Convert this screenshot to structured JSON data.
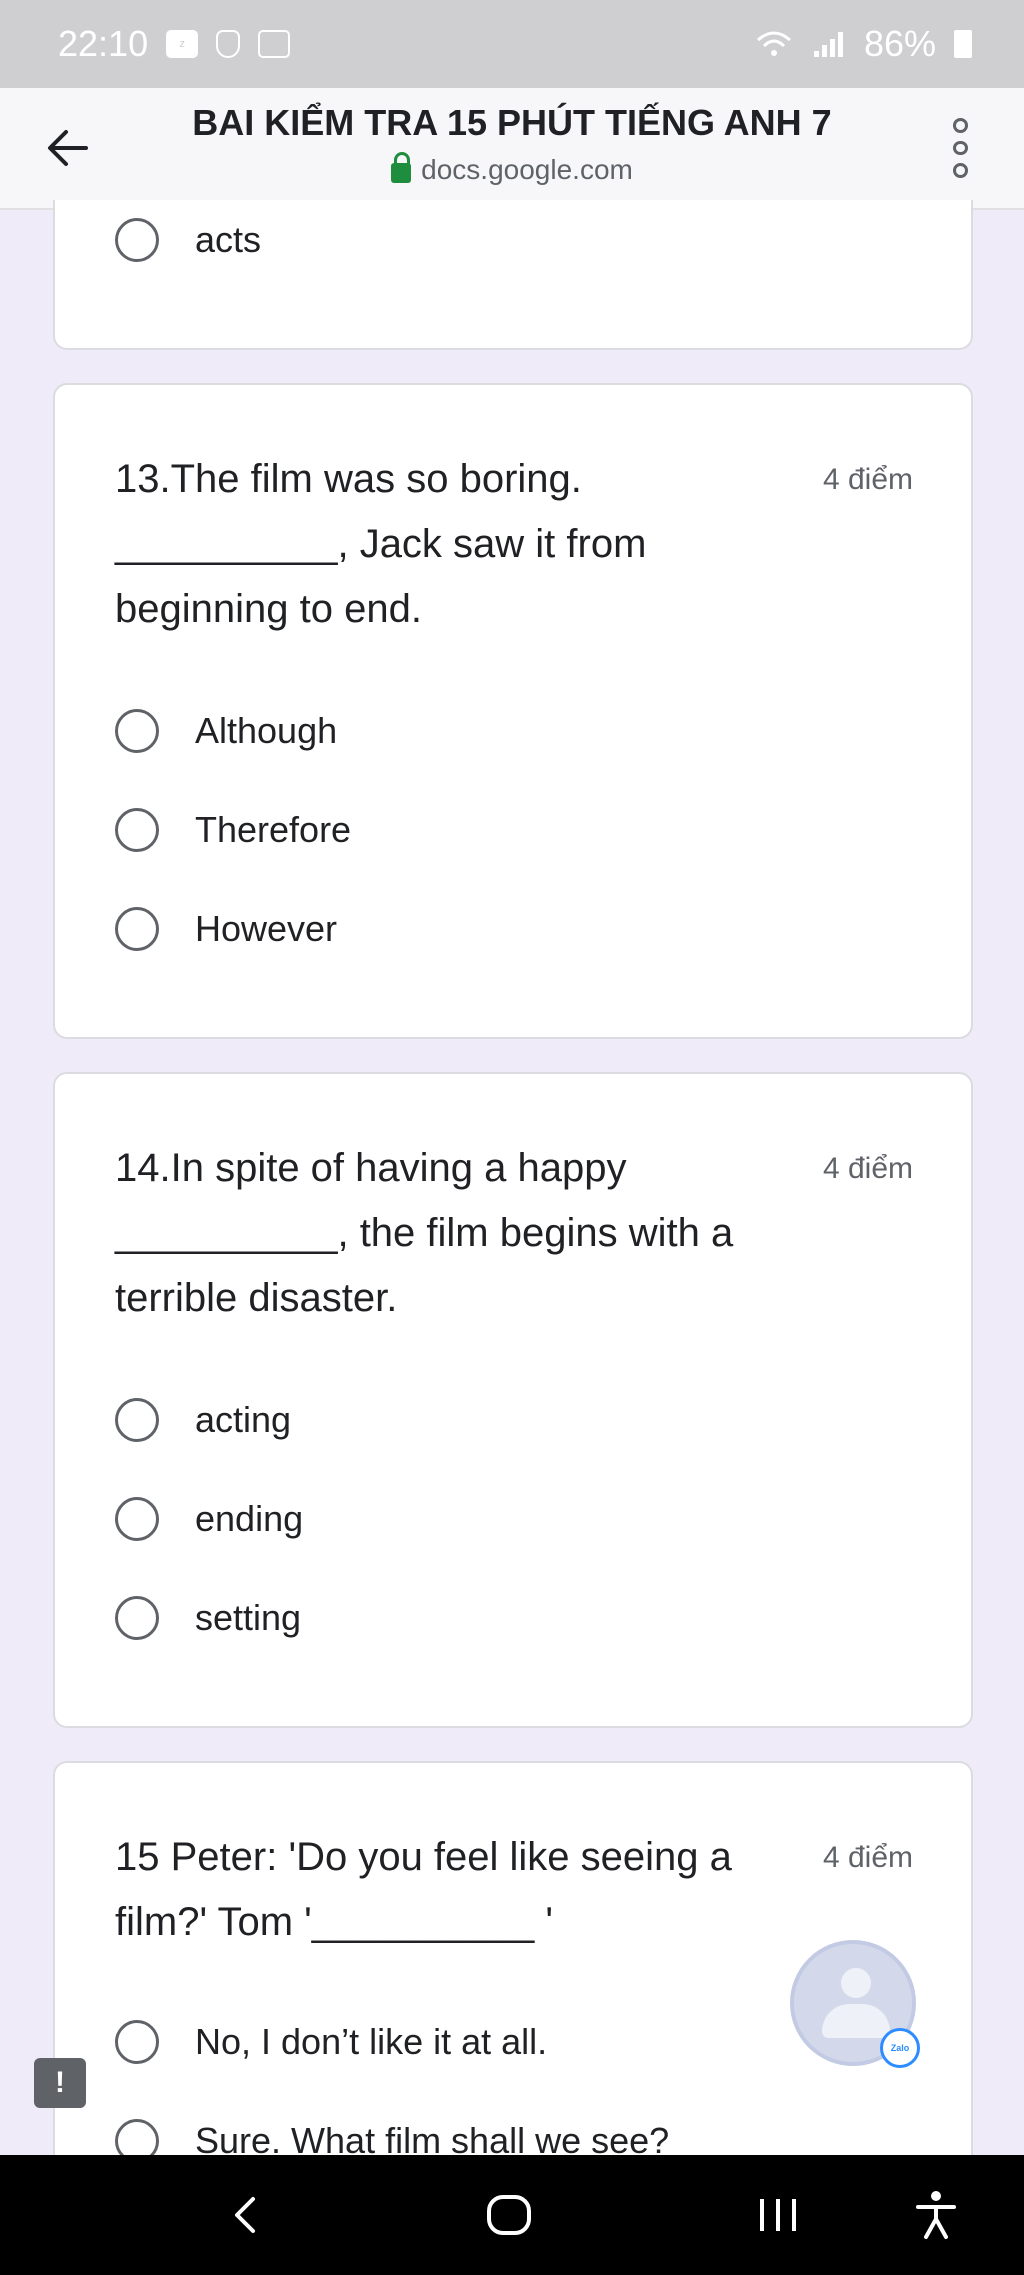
{
  "status_bar": {
    "time": "22:10",
    "battery": "86%",
    "icons": [
      "zalo-icon",
      "shield-icon",
      "image-icon",
      "wifi-icon",
      "signal-icon",
      "battery-icon"
    ]
  },
  "browser": {
    "title": "BAI KIỂM TRA 15 PHÚT TIẾNG ANH 7",
    "url": "docs.google.com"
  },
  "prev_card": {
    "options": [
      "acts"
    ]
  },
  "questions": [
    {
      "lines": [
        "13.The film was so boring.",
        "__________, Jack saw it from",
        "beginning to end."
      ],
      "points": "4 điểm",
      "options": [
        "Although",
        "Therefore",
        "However"
      ]
    },
    {
      "lines": [
        "14.In spite of having a happy",
        "__________, the film begins with a",
        "terrible disaster."
      ],
      "points": "4 điểm",
      "options": [
        "acting",
        "ending",
        "setting"
      ]
    },
    {
      "lines": [
        "15 Peter: 'Do you feel like seeing a",
        "film?' Tom '__________ '"
      ],
      "points": "4 điểm",
      "options": [
        "No, I don’t like it at all.",
        "Sure. What film shall we see?"
      ]
    }
  ],
  "floating": {
    "zalo_badge": "Zalo",
    "feedback": "!"
  },
  "colors": {
    "page_bg": "#f0ebf8",
    "status_bar": "#cfcfd1",
    "lock": "#1e8e3e",
    "nav_bar": "#000000"
  }
}
